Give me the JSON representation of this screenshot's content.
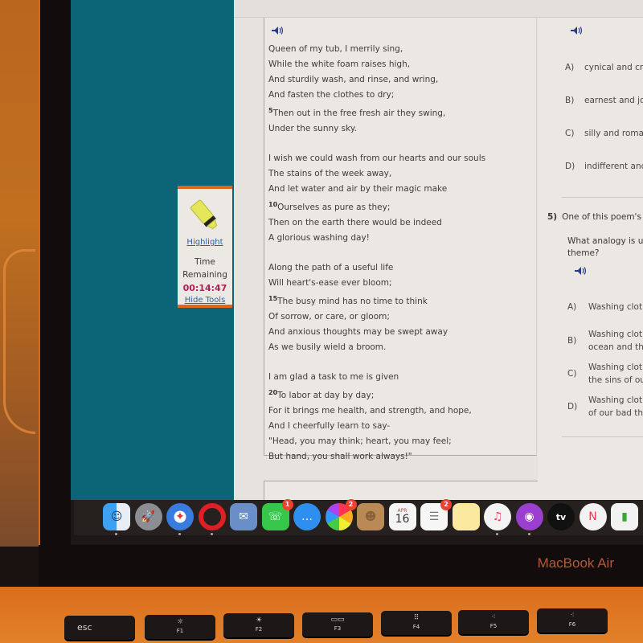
{
  "toolbox": {
    "highlight_label": "Highlight",
    "time_label_1": "Time",
    "time_label_2": "Remaining",
    "time_remaining": "00:14:47",
    "hide_tools_label": "Hide Tools",
    "accent_color": "#e3641d",
    "timer_color": "#b02056"
  },
  "passage": {
    "audio_icon": "speaker-icon",
    "stanzas": [
      [
        {
          "num": "",
          "text": "Queen of my tub, I merrily sing,"
        },
        {
          "num": "",
          "text": "While the white foam raises high,"
        },
        {
          "num": "",
          "text": "And sturdily wash, and rinse, and wring,"
        },
        {
          "num": "",
          "text": "And fasten the clothes to dry;"
        },
        {
          "num": "5",
          "text": "Then out in the free fresh air they swing,"
        },
        {
          "num": "",
          "text": "Under the sunny sky."
        }
      ],
      [
        {
          "num": "",
          "text": "I wish we could wash from our hearts and our souls"
        },
        {
          "num": "",
          "text": "The stains of the week away,"
        },
        {
          "num": "",
          "text": "And let water and air by their magic make"
        },
        {
          "num": "10",
          "text": "Ourselves as pure as they;"
        },
        {
          "num": "",
          "text": "Then on the earth there would be indeed"
        },
        {
          "num": "",
          "text": "A glorious washing day!"
        }
      ],
      [
        {
          "num": "",
          "text": "Along the path of a useful life"
        },
        {
          "num": "",
          "text": "Will heart's-ease ever bloom;"
        },
        {
          "num": "15",
          "text": "The busy mind has no time to think"
        },
        {
          "num": "",
          "text": "Of sorrow, or care, or gloom;"
        },
        {
          "num": "",
          "text": "And anxious thoughts may be swept away"
        },
        {
          "num": "",
          "text": "As we busily wield a broom."
        }
      ],
      [
        {
          "num": "",
          "text": "I am glad a task to me is given"
        },
        {
          "num": "20",
          "text": "To labor at day by day;"
        },
        {
          "num": "",
          "text": "For it brings me health, and strength, and hope,"
        },
        {
          "num": "",
          "text": "And I cheerfully learn to say-"
        },
        {
          "num": "",
          "text": "\"Head, you may think; heart, you may feel;"
        },
        {
          "num": "",
          "text": "But hand, you shall work always!\""
        }
      ]
    ]
  },
  "question4": {
    "options": [
      {
        "label": "A)",
        "text": "cynical and cru"
      },
      {
        "label": "B)",
        "text": "earnest and joy"
      },
      {
        "label": "C)",
        "text": "silly and romar"
      },
      {
        "label": "D)",
        "text": "indifferent and"
      }
    ]
  },
  "question5": {
    "number": "5)",
    "title": "One of this poem's",
    "prompt_line1": "What analogy is use",
    "prompt_line2": "theme?",
    "options": [
      {
        "label": "A)",
        "line1": "Washing cloth",
        "line2": ""
      },
      {
        "label": "B)",
        "line1": "Washing cloth",
        "line2": "ocean and the"
      },
      {
        "label": "C)",
        "line1": "Washing cloth",
        "line2": "the sins of ou"
      },
      {
        "label": "D)",
        "line1": "Washing cloth",
        "line2": "of our bad tho"
      }
    ]
  },
  "dock": {
    "apps": [
      {
        "name": "Finder",
        "icon": "finder-icon",
        "badge": "",
        "running": true
      },
      {
        "name": "Launchpad",
        "icon": "rocket-icon",
        "badge": "",
        "running": false
      },
      {
        "name": "Safari",
        "icon": "compass-icon",
        "badge": "",
        "running": true
      },
      {
        "name": "Opera",
        "icon": "opera-icon",
        "badge": "",
        "running": true
      },
      {
        "name": "Preview",
        "icon": "eagle-stamp-icon",
        "badge": "",
        "running": false
      },
      {
        "name": "FaceTime",
        "icon": "facetime-icon",
        "badge": "1",
        "running": false
      },
      {
        "name": "Messages",
        "icon": "message-bubble-icon",
        "badge": "",
        "running": false
      },
      {
        "name": "Photos",
        "icon": "photos-flower-icon",
        "badge": "2",
        "running": false
      },
      {
        "name": "Contacts",
        "icon": "contacts-book-icon",
        "badge": "",
        "running": false
      },
      {
        "name": "Calendar",
        "icon": "calendar-icon",
        "badge": "",
        "running": false,
        "month": "APR",
        "day": "16"
      },
      {
        "name": "Reminders",
        "icon": "reminders-list-icon",
        "badge": "2",
        "running": false
      },
      {
        "name": "Notes",
        "icon": "notes-icon",
        "badge": "",
        "running": false
      },
      {
        "name": "Music",
        "icon": "music-note-icon",
        "badge": "",
        "running": true
      },
      {
        "name": "Podcasts",
        "icon": "podcast-icon",
        "badge": "",
        "running": true
      },
      {
        "name": "TV",
        "icon": "apple-tv-icon",
        "badge": "",
        "running": false,
        "glyph": "tv"
      },
      {
        "name": "News",
        "icon": "news-icon",
        "badge": "",
        "running": false
      },
      {
        "name": "Numbers",
        "icon": "bar-chart-icon",
        "badge": "",
        "running": false
      }
    ]
  },
  "device": {
    "brand": "MacBook Air",
    "keys": [
      {
        "label": "esc",
        "fn": ""
      },
      {
        "label": "☼",
        "fn": "F1"
      },
      {
        "label": "☀",
        "fn": "F2"
      },
      {
        "label": "▭▭",
        "fn": "F3"
      },
      {
        "label": "⠿",
        "fn": "F4"
      },
      {
        "label": "⁖",
        "fn": "F5"
      },
      {
        "label": "⁖",
        "fn": "F6"
      }
    ]
  }
}
